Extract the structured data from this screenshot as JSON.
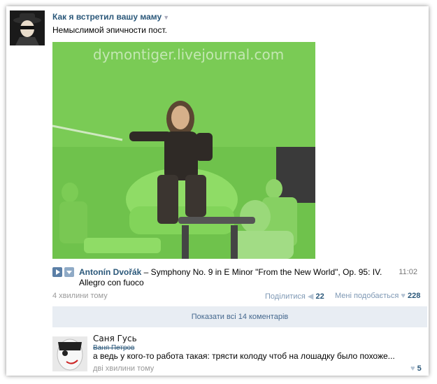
{
  "post": {
    "author": "Как я встретил вашу маму",
    "text": "Немыслимой эпичности пост.",
    "watermark": "dymontiger.livejournal.com",
    "timestamp": "4 хвилини тому",
    "share_label": "Поділитися",
    "share_count": "22",
    "like_label": "Мені подобається",
    "like_count": "228"
  },
  "audio": {
    "artist": "Antonín Dvořák",
    "title": " – Symphony No. 9 in E Minor \"From the New World\", Op. 95: IV. Allegro con fuoco",
    "duration": "11:02"
  },
  "show_comments_label": "Показати всі 14 коментарів",
  "comment": {
    "name": "Саня Гусь",
    "struck_name": "Ваня Петров",
    "text": "а ведь у кого-то работа такая: трясти колоду чтоб на лошадку было похоже...",
    "timestamp": "дві хвилини тому",
    "like_count": "5"
  },
  "colors": {
    "link": "#2b587a",
    "muted": "#999999",
    "button_bg": "#e8edf3",
    "greenscreen": "#6fc24c"
  },
  "icons": [
    "user-avatar-icon",
    "play-icon",
    "add-icon",
    "share-icon",
    "heart-icon"
  ]
}
